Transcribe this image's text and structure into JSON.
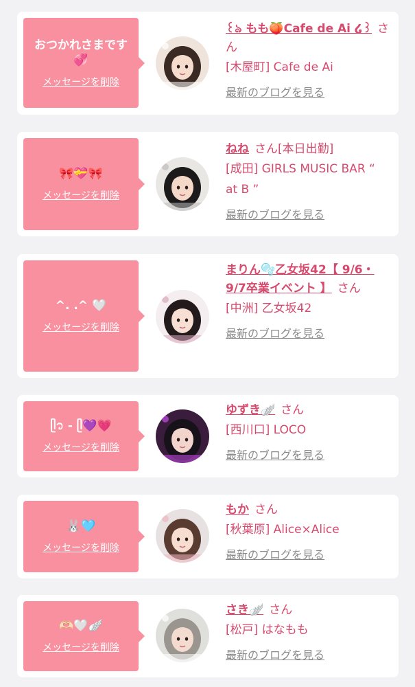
{
  "common": {
    "delete_label": "メッセージを削除",
    "blog_label": "最新のブログを見る",
    "san_label": "さん"
  },
  "colors": {
    "bubble": "#f9909f",
    "accent": "#d64a6d",
    "muted_link": "#8a8a8a",
    "background": "#f2f2f4"
  },
  "items": [
    {
      "message": "おつかれさまです💞",
      "name": "꒰ঌ もも🍑Cafe de Ai ໒꒱",
      "extra": "",
      "shop": "[木屋町] Cafe de Ai",
      "avatar_icon": "girl-avatar-cat-ears"
    },
    {
      "message": "🎀💝🎀",
      "name": "ねね",
      "extra": "[本日出勤]",
      "shop": "[成田] GIRLS MUSIC BAR “ at B ”",
      "avatar_icon": "girl-avatar-phone-selfie"
    },
    {
      "message": "^. .^ 🤍",
      "name": "まりん🫧乙女坂42【 9/6・9/7卒業イベント 】",
      "extra": "",
      "shop": "[中洲] 乙女坂42",
      "avatar_icon": "girl-avatar-maid"
    },
    {
      "message": "ᥫ᭡ - ᥫ💜💗",
      "name": "ゆずき🪽",
      "extra": "",
      "shop": "[西川口] LOCO",
      "avatar_icon": "girl-avatar-neon"
    },
    {
      "message": "🐰🩵",
      "name": "もか",
      "extra": "",
      "shop": "[秋葉原] Alice×Alice",
      "avatar_icon": "girl-avatar-pigtails"
    },
    {
      "message": "🫶🏻🤍🪽",
      "name": "さき🪽",
      "extra": "",
      "shop": "[松戸] はなもも",
      "avatar_icon": "girl-avatar-gray-hair"
    }
  ]
}
